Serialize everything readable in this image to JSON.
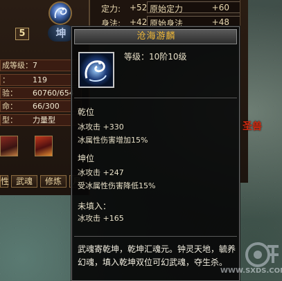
{
  "character_panel": {
    "crest_text": "坤",
    "level_badge": "5",
    "stats": [
      {
        "label": "成等级：",
        "value": "7"
      },
      {
        "label": "：",
        "value": "119"
      },
      {
        "label": "验：",
        "value": "60760/654"
      },
      {
        "label": "命：",
        "value": "66/300"
      },
      {
        "label": "型：",
        "value": "力量型"
      }
    ],
    "tabs": [
      "性",
      "武魂",
      "修炼",
      "月"
    ]
  },
  "attributes": [
    {
      "label": "定力:",
      "value": "+52",
      "base_label": "原始定力",
      "base_value": "+60"
    },
    {
      "label": "身法:",
      "value": "+42",
      "base_label": "原始身法",
      "base_value": "+48"
    }
  ],
  "tooltip": {
    "title": "沧海游麟",
    "level_text": "等级：10阶10级",
    "qian_heading": "乾位",
    "qian_line1": "冰攻击 +330",
    "qian_line2": "冰属性伤害增加15%",
    "kun_heading": "坤位",
    "kun_line1": "冰攻击 +247",
    "kun_line2": "受冰属性伤害降低15%",
    "unfilled_heading": "未填入：",
    "unfilled_line": "冰攻击 +165",
    "description": "武魂寄乾坤，乾坤汇魂元。钟灵天地，毓养幻魂，填入乾坤双位可幻武魂，夺生杀。"
  },
  "scene": {
    "red_label": "圣兽",
    "watermark": "WWW.SXDS.COM"
  },
  "colors": {
    "title_gold": "#f0b838",
    "tooltip_bg": "#080808",
    "panel_brown": "#2a1d14"
  },
  "icons": {
    "item_icon": "ice-dragon-icon",
    "crest_icon": "dragon-crest-icon"
  }
}
